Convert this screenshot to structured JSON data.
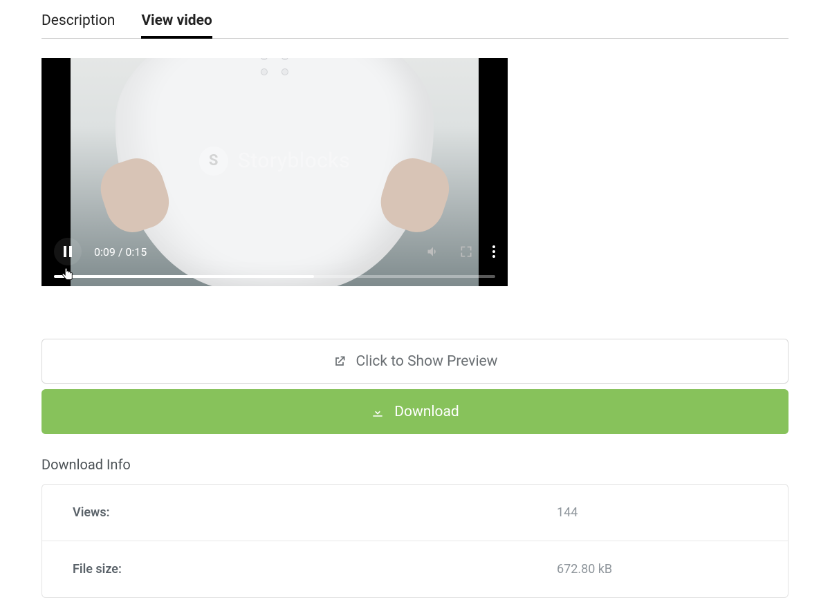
{
  "tabs": {
    "description": "Description",
    "view_video": "View video"
  },
  "watermark": {
    "text": "Storyblocks",
    "symbol": "S"
  },
  "player": {
    "current_time": "0:09",
    "duration": "0:15",
    "progress_percent": 59
  },
  "actions": {
    "preview": "Click to Show Preview",
    "download": "Download"
  },
  "download_info": {
    "title": "Download Info",
    "rows": [
      {
        "label": "Views:",
        "value": "144"
      },
      {
        "label": "File size:",
        "value": "672.80 kB"
      }
    ]
  }
}
